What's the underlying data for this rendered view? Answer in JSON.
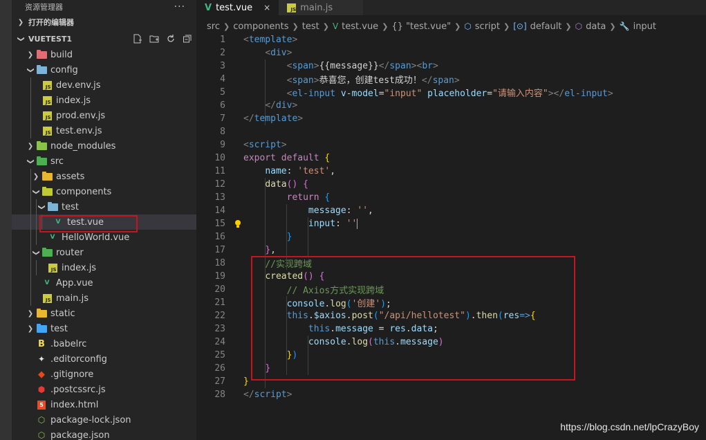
{
  "explorer": {
    "title": "资源管理器",
    "more": "···",
    "open_editors": "打开的编辑器",
    "project": "VUETEST1",
    "tree": [
      {
        "label": "build",
        "depth": 0,
        "type": "folder",
        "open": false,
        "color": "#e06c75"
      },
      {
        "label": "config",
        "depth": 0,
        "type": "folder",
        "open": true,
        "color": "#7eb3d8"
      },
      {
        "label": "dev.env.js",
        "depth": 1,
        "type": "js"
      },
      {
        "label": "index.js",
        "depth": 1,
        "type": "js"
      },
      {
        "label": "prod.env.js",
        "depth": 1,
        "type": "js"
      },
      {
        "label": "test.env.js",
        "depth": 1,
        "type": "js"
      },
      {
        "label": "node_modules",
        "depth": 0,
        "type": "folder",
        "open": false,
        "color": "#8bc34a"
      },
      {
        "label": "src",
        "depth": 0,
        "type": "folder",
        "open": true,
        "color": "#4caf50"
      },
      {
        "label": "assets",
        "depth": 1,
        "type": "folder",
        "open": false,
        "color": "#e8b62f"
      },
      {
        "label": "components",
        "depth": 1,
        "type": "folder",
        "open": true,
        "color": "#c0ca33"
      },
      {
        "label": "test",
        "depth": 2,
        "type": "folder",
        "open": true,
        "color": "#7eb3d8"
      },
      {
        "label": "test.vue",
        "depth": 3,
        "type": "vue",
        "selected": true
      },
      {
        "label": "HelloWorld.vue",
        "depth": 2,
        "type": "vue"
      },
      {
        "label": "router",
        "depth": 1,
        "type": "folder",
        "open": true,
        "color": "#4caf50"
      },
      {
        "label": "index.js",
        "depth": 2,
        "type": "js"
      },
      {
        "label": "App.vue",
        "depth": 1,
        "type": "vue"
      },
      {
        "label": "main.js",
        "depth": 1,
        "type": "js"
      },
      {
        "label": "static",
        "depth": 0,
        "type": "folder",
        "open": false,
        "color": "#e8b62f"
      },
      {
        "label": "test",
        "depth": 0,
        "type": "folder",
        "open": false,
        "color": "#42a5f5"
      },
      {
        "label": ".babelrc",
        "depth": 0,
        "type": "babel"
      },
      {
        "label": ".editorconfig",
        "depth": 0,
        "type": "config"
      },
      {
        "label": ".gitignore",
        "depth": 0,
        "type": "git"
      },
      {
        "label": ".postcssrc.js",
        "depth": 0,
        "type": "postcss"
      },
      {
        "label": "index.html",
        "depth": 0,
        "type": "html"
      },
      {
        "label": "package-lock.json",
        "depth": 0,
        "type": "npm"
      },
      {
        "label": "package.json",
        "depth": 0,
        "type": "npm"
      }
    ]
  },
  "tabs": [
    {
      "label": "test.vue",
      "active": true,
      "icon": "vue-icon",
      "close": "×"
    },
    {
      "label": "main.js",
      "active": false,
      "icon": "js-icon"
    }
  ],
  "breadcrumbs": [
    "src",
    "components",
    "test",
    "test.vue",
    "{} \"test.vue\"",
    "script",
    "default",
    "data",
    "input"
  ],
  "code_lines": [
    [
      [
        "t",
        "<"
      ],
      [
        "tn",
        "template"
      ],
      [
        "t",
        ">"
      ]
    ],
    [
      [
        "i",
        "    "
      ],
      [
        "t",
        "<"
      ],
      [
        "tn",
        "div"
      ],
      [
        "t",
        ">"
      ]
    ],
    [
      [
        "i",
        "        "
      ],
      [
        "t",
        "<"
      ],
      [
        "tn",
        "span"
      ],
      [
        "t",
        ">"
      ],
      [
        "tx",
        "{{message}}"
      ],
      [
        "t",
        "</"
      ],
      [
        "tn",
        "span"
      ],
      [
        "t",
        "><"
      ],
      [
        "tn",
        "br"
      ],
      [
        "t",
        ">"
      ]
    ],
    [
      [
        "i",
        "        "
      ],
      [
        "t",
        "<"
      ],
      [
        "tn",
        "span"
      ],
      [
        "t",
        ">"
      ],
      [
        "tx",
        "恭喜您，创建test成功！"
      ],
      [
        "t",
        "</"
      ],
      [
        "tn",
        "span"
      ],
      [
        "t",
        ">"
      ]
    ],
    [
      [
        "i",
        "        "
      ],
      [
        "t",
        "<"
      ],
      [
        "tn",
        "el-input"
      ],
      [
        "tx",
        " "
      ],
      [
        "at",
        "v-model"
      ],
      [
        "tx",
        "="
      ],
      [
        "st",
        "\"input\""
      ],
      [
        "tx",
        " "
      ],
      [
        "at",
        "placeholder"
      ],
      [
        "tx",
        "="
      ],
      [
        "st",
        "\"请输入内容\""
      ],
      [
        "t",
        "></"
      ],
      [
        "tn",
        "el-input"
      ],
      [
        "t",
        ">"
      ]
    ],
    [
      [
        "i",
        "    "
      ],
      [
        "t",
        "</"
      ],
      [
        "tn",
        "div"
      ],
      [
        "t",
        ">"
      ]
    ],
    [
      [
        "t",
        "</"
      ],
      [
        "tn",
        "template"
      ],
      [
        "t",
        ">"
      ]
    ],
    [],
    [
      [
        "t",
        "<"
      ],
      [
        "tn",
        "script"
      ],
      [
        "t",
        ">"
      ]
    ],
    [
      [
        "kw",
        "export"
      ],
      [
        "pu",
        " "
      ],
      [
        "kw",
        "default"
      ],
      [
        "pu",
        " "
      ],
      [
        "br1",
        "{"
      ]
    ],
    [
      [
        "i",
        "    "
      ],
      [
        "pr",
        "name"
      ],
      [
        "pu",
        ": "
      ],
      [
        "st",
        "'test'"
      ],
      [
        "pu",
        ","
      ]
    ],
    [
      [
        "i",
        "    "
      ],
      [
        "fn",
        "data"
      ],
      [
        "br2",
        "()"
      ],
      [
        "pu",
        " "
      ],
      [
        "br2",
        "{"
      ]
    ],
    [
      [
        "i",
        "        "
      ],
      [
        "kw",
        "return"
      ],
      [
        "pu",
        " "
      ],
      [
        "br3",
        "{"
      ]
    ],
    [
      [
        "i",
        "            "
      ],
      [
        "pr",
        "message"
      ],
      [
        "pu",
        ": "
      ],
      [
        "st",
        "''"
      ],
      [
        "pu",
        ","
      ]
    ],
    [
      [
        "i",
        "            "
      ],
      [
        "pr",
        "input"
      ],
      [
        "pu",
        ": "
      ],
      [
        "st",
        "''"
      ],
      [
        "cur",
        ""
      ]
    ],
    [
      [
        "i",
        "        "
      ],
      [
        "br3",
        "}"
      ]
    ],
    [
      [
        "i",
        "    "
      ],
      [
        "br2",
        "}"
      ],
      [
        "pu",
        ","
      ]
    ],
    [
      [
        "i",
        "    "
      ],
      [
        "cm",
        "//实现跨域"
      ]
    ],
    [
      [
        "i",
        "    "
      ],
      [
        "fn",
        "created"
      ],
      [
        "br2",
        "()"
      ],
      [
        "pu",
        " "
      ],
      [
        "br2",
        "{"
      ]
    ],
    [
      [
        "i",
        "        "
      ],
      [
        "cm",
        "// Axios方式实现跨域"
      ]
    ],
    [
      [
        "i",
        "        "
      ],
      [
        "pr",
        "console"
      ],
      [
        "pu",
        "."
      ],
      [
        "fn",
        "log"
      ],
      [
        "br3",
        "("
      ],
      [
        "st",
        "'创建'"
      ],
      [
        "br3",
        ")"
      ],
      [
        "pu",
        ";"
      ]
    ],
    [
      [
        "i",
        "        "
      ],
      [
        "th",
        "this"
      ],
      [
        "pu",
        "."
      ],
      [
        "pr",
        "$axios"
      ],
      [
        "pu",
        "."
      ],
      [
        "fn",
        "post"
      ],
      [
        "br3",
        "("
      ],
      [
        "st",
        "\"/api/hellotest\""
      ],
      [
        "br3",
        ")"
      ],
      [
        "pu",
        "."
      ],
      [
        "fn",
        "then"
      ],
      [
        "br3",
        "("
      ],
      [
        "pr",
        "res"
      ],
      [
        "th",
        "=>"
      ],
      [
        "br1",
        "{"
      ]
    ],
    [
      [
        "i",
        "            "
      ],
      [
        "th",
        "this"
      ],
      [
        "pu",
        "."
      ],
      [
        "pr",
        "message"
      ],
      [
        "pu",
        " = "
      ],
      [
        "pr",
        "res"
      ],
      [
        "pu",
        "."
      ],
      [
        "pr",
        "data"
      ],
      [
        "pu",
        ";"
      ]
    ],
    [
      [
        "i",
        "            "
      ],
      [
        "pr",
        "console"
      ],
      [
        "pu",
        "."
      ],
      [
        "fn",
        "log"
      ],
      [
        "br2",
        "("
      ],
      [
        "th",
        "this"
      ],
      [
        "pu",
        "."
      ],
      [
        "pr",
        "message"
      ],
      [
        "br2",
        ")"
      ]
    ],
    [
      [
        "i",
        "        "
      ],
      [
        "br1",
        "}"
      ],
      [
        "br3",
        ")"
      ]
    ],
    [
      [
        "i",
        "    "
      ],
      [
        "br2",
        "}"
      ]
    ],
    [
      [
        "br1",
        "}"
      ]
    ],
    [
      [
        "t",
        "</"
      ],
      [
        "tn",
        "script"
      ],
      [
        "t",
        ">"
      ]
    ]
  ],
  "watermark": "https://blog.csdn.net/lpCrazyBoy"
}
